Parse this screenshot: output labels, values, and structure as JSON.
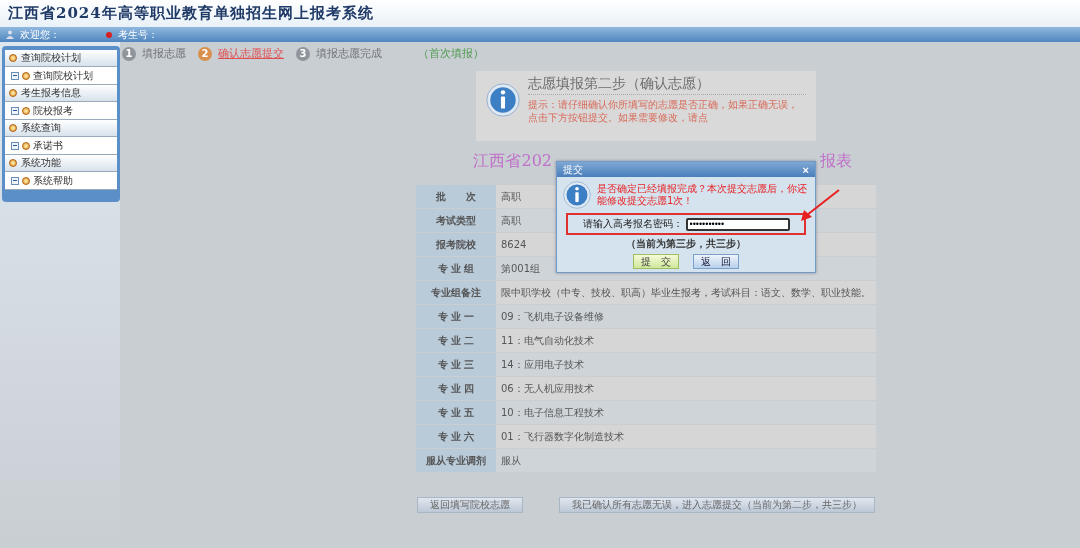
{
  "header": {
    "title": "江西省2024年高等职业教育单独招生网上报考系统"
  },
  "user_bar": {
    "welcome": "欢迎您：",
    "candidate_label": "考生号："
  },
  "sidebar": {
    "groups": [
      {
        "label": "查询院校计划",
        "children": [
          {
            "label": "查询院校计划"
          }
        ]
      },
      {
        "label": "考生报考信息",
        "children": [
          {
            "label": "院校报考"
          }
        ]
      },
      {
        "label": "系统查询",
        "children": [
          {
            "label": "承诺书"
          }
        ]
      },
      {
        "label": "系统功能",
        "children": [
          {
            "label": "系统帮助"
          }
        ]
      }
    ]
  },
  "steps": [
    {
      "number": "1",
      "label": "填报志愿",
      "selected": false
    },
    {
      "number": "2",
      "label": "确认志愿提交",
      "selected": true
    },
    {
      "number": "3",
      "label": "填报志愿完成",
      "selected": false
    }
  ],
  "fill_note": "（首次填报）",
  "notice": {
    "title": "志愿填报第二步（确认志愿）",
    "text": "提示：请仔细确认你所填写的志愿是否正确，如果正确无误，点击下方按钮提交。如果需要修改，请点"
  },
  "form_title": {
    "left": "江西省202",
    "right": "报表"
  },
  "table": {
    "rows": [
      {
        "label": "批　　次",
        "value": "高职"
      },
      {
        "label": "考试类型",
        "value": "高职"
      },
      {
        "label": "报考院校",
        "value": "8624"
      },
      {
        "label": "专 业 组",
        "value": "第001组"
      },
      {
        "label": "专业组备注",
        "value": "限中职学校（中专、技校、职高）毕业生报考，考试科目：语文、数学、职业技能。"
      },
      {
        "label": "专 业 一",
        "value": "09：飞机电子设备维修"
      },
      {
        "label": "专 业 二",
        "value": "11：电气自动化技术"
      },
      {
        "label": "专 业 三",
        "value": "14：应用电子技术"
      },
      {
        "label": "专 业 四",
        "value": "06：无人机应用技术"
      },
      {
        "label": "专 业 五",
        "value": "10：电子信息工程技术"
      },
      {
        "label": "专 业 六",
        "value": "01：飞行器数字化制造技术"
      },
      {
        "label": "服从专业调剂",
        "value": "服从"
      }
    ]
  },
  "buttons": [
    "返回填写院校志愿",
    "我已确认所有志愿无误，进入志愿提交（当前为第二步，共三步）"
  ],
  "dialog": {
    "title": "提交",
    "close": "×",
    "message": "是否确定已经填报完成？本次提交志愿后，你还能修改提交志愿1次！",
    "field_label": "请输入高考报名密码：",
    "password": "•••••••••••",
    "step_note": "（当前为第三步，共三步）",
    "buttons": [
      {
        "label": "提　交",
        "kind": "submit"
      },
      {
        "label": "返　回",
        "kind": "back"
      }
    ]
  }
}
